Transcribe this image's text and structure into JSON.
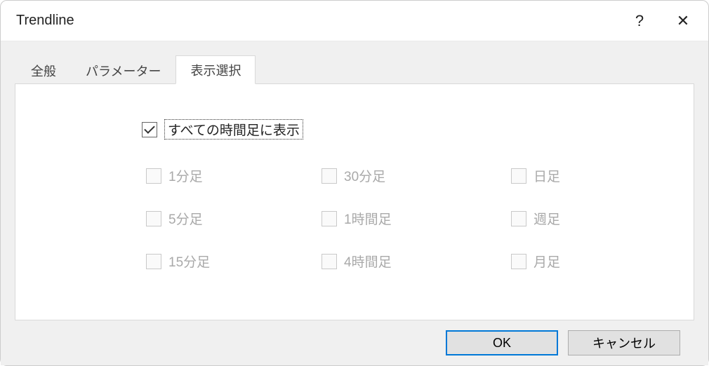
{
  "title": "Trendline",
  "help": "?",
  "close": "✕",
  "tabs": {
    "general": "全般",
    "parameters": "パラメーター",
    "visualization": "表示選択"
  },
  "master": {
    "label": "すべての時間足に表示",
    "checked": true
  },
  "timeframes": {
    "m1": "1分足",
    "m5": "5分足",
    "m15": "15分足",
    "m30": "30分足",
    "h1": "1時間足",
    "h4": "4時間足",
    "d1": "日足",
    "w1": "週足",
    "mn1": "月足"
  },
  "buttons": {
    "ok": "OK",
    "cancel": "キャンセル"
  }
}
